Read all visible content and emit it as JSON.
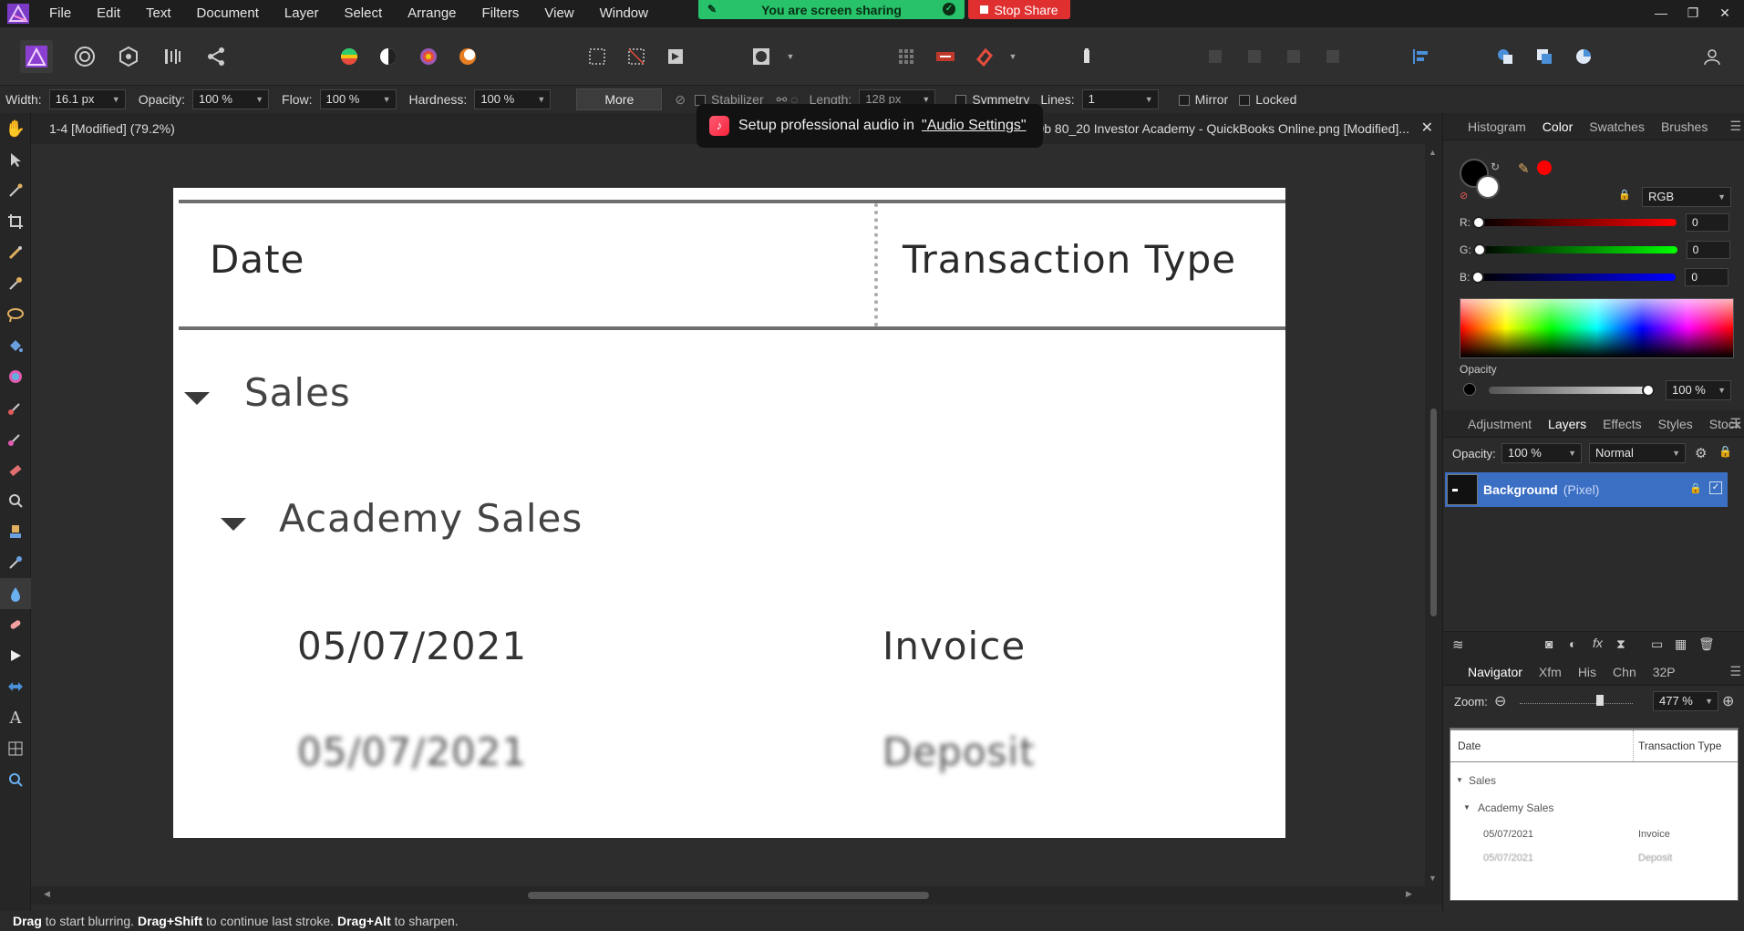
{
  "menubar": {
    "items": [
      "File",
      "Edit",
      "Text",
      "Document",
      "Layer",
      "Select",
      "Arrange",
      "Filters",
      "View",
      "Window"
    ],
    "screen_sharing": "You are screen sharing",
    "stop_share": "Stop Share"
  },
  "context": {
    "width_label": "Width:",
    "width_value": "16.1 px",
    "opacity_label": "Opacity:",
    "opacity_value": "100 %",
    "flow_label": "Flow:",
    "flow_value": "100 %",
    "hardness_label": "Hardness:",
    "hardness_value": "100 %",
    "more": "More",
    "stabilizer": "Stabilizer",
    "length_label": "Length:",
    "length_value": "128 px",
    "symmetry": "Symmetry",
    "lines_label": "Lines:",
    "lines_value": "1",
    "mirror": "Mirror",
    "locked": "Locked"
  },
  "document": {
    "title_left": "1-4 [Modified] (79.2%)",
    "title_right": "a9b 80_20 Investor Academy - QuickBooks Online.png [Modified]...",
    "header_date": "Date",
    "header_type": "Transaction Type",
    "group_sales": "Sales",
    "group_academy": "Academy Sales",
    "rows": [
      {
        "date": "05/07/2021",
        "type": "Invoice"
      },
      {
        "date": "05/07/2021",
        "type": "Deposit"
      }
    ]
  },
  "toast": {
    "text": "Setup professional audio in",
    "link": "\"Audio Settings\""
  },
  "color_panel": {
    "tabs": [
      "Histogram",
      "Color",
      "Swatches",
      "Brushes"
    ],
    "active_tab": "Color",
    "mode": "RGB",
    "r_label": "R:",
    "r_value": "0",
    "g_label": "G:",
    "g_value": "0",
    "b_label": "B:",
    "b_value": "0",
    "opacity_label": "Opacity",
    "opacity_value": "100 %"
  },
  "layers_panel": {
    "tabs": [
      "Adjustment",
      "Layers",
      "Effects",
      "Styles",
      "Stock"
    ],
    "active_tab": "Layers",
    "opacity_label": "Opacity:",
    "opacity_value": "100 %",
    "blend_mode": "Normal",
    "layer_name": "Background",
    "layer_type": "(Pixel)"
  },
  "navigator_panel": {
    "tabs": [
      "Navigator",
      "Xfm",
      "His",
      "Chn",
      "32P"
    ],
    "active_tab": "Navigator",
    "zoom_label": "Zoom:",
    "zoom_value": "477 %"
  },
  "statusbar": {
    "drag1": "Drag",
    "text1": " to start blurring. ",
    "drag2": "Drag+Shift",
    "text2": " to continue last stroke. ",
    "drag3": "Drag+Alt",
    "text3": " to sharpen."
  },
  "colors": {
    "accent": "#3b6fc4",
    "share_green": "#27c26a",
    "stop_red": "#e02f2f"
  }
}
